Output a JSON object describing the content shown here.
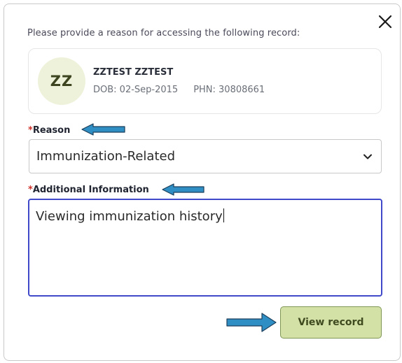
{
  "dialog": {
    "prompt": "Please provide a reason for accessing the following record:",
    "close_icon": "close-icon"
  },
  "patient": {
    "initials": "ZZ",
    "name": "ZZTEST ZZTEST",
    "dob": "DOB: 02-Sep-2015",
    "phn": "PHN: 30808661"
  },
  "reason": {
    "required_marker": "*",
    "label": "Reason",
    "selected": "Immunization-Related"
  },
  "additional_info": {
    "required_marker": "*",
    "label": "Additional Information",
    "value": "Viewing immunization history"
  },
  "actions": {
    "view_record": "View record"
  },
  "colors": {
    "accent_border": "#3f49c9",
    "button_bg": "#d3e1a7",
    "avatar_bg": "#eef2da",
    "annotation_arrow": "#2f8fc4",
    "required": "#d0342c"
  }
}
